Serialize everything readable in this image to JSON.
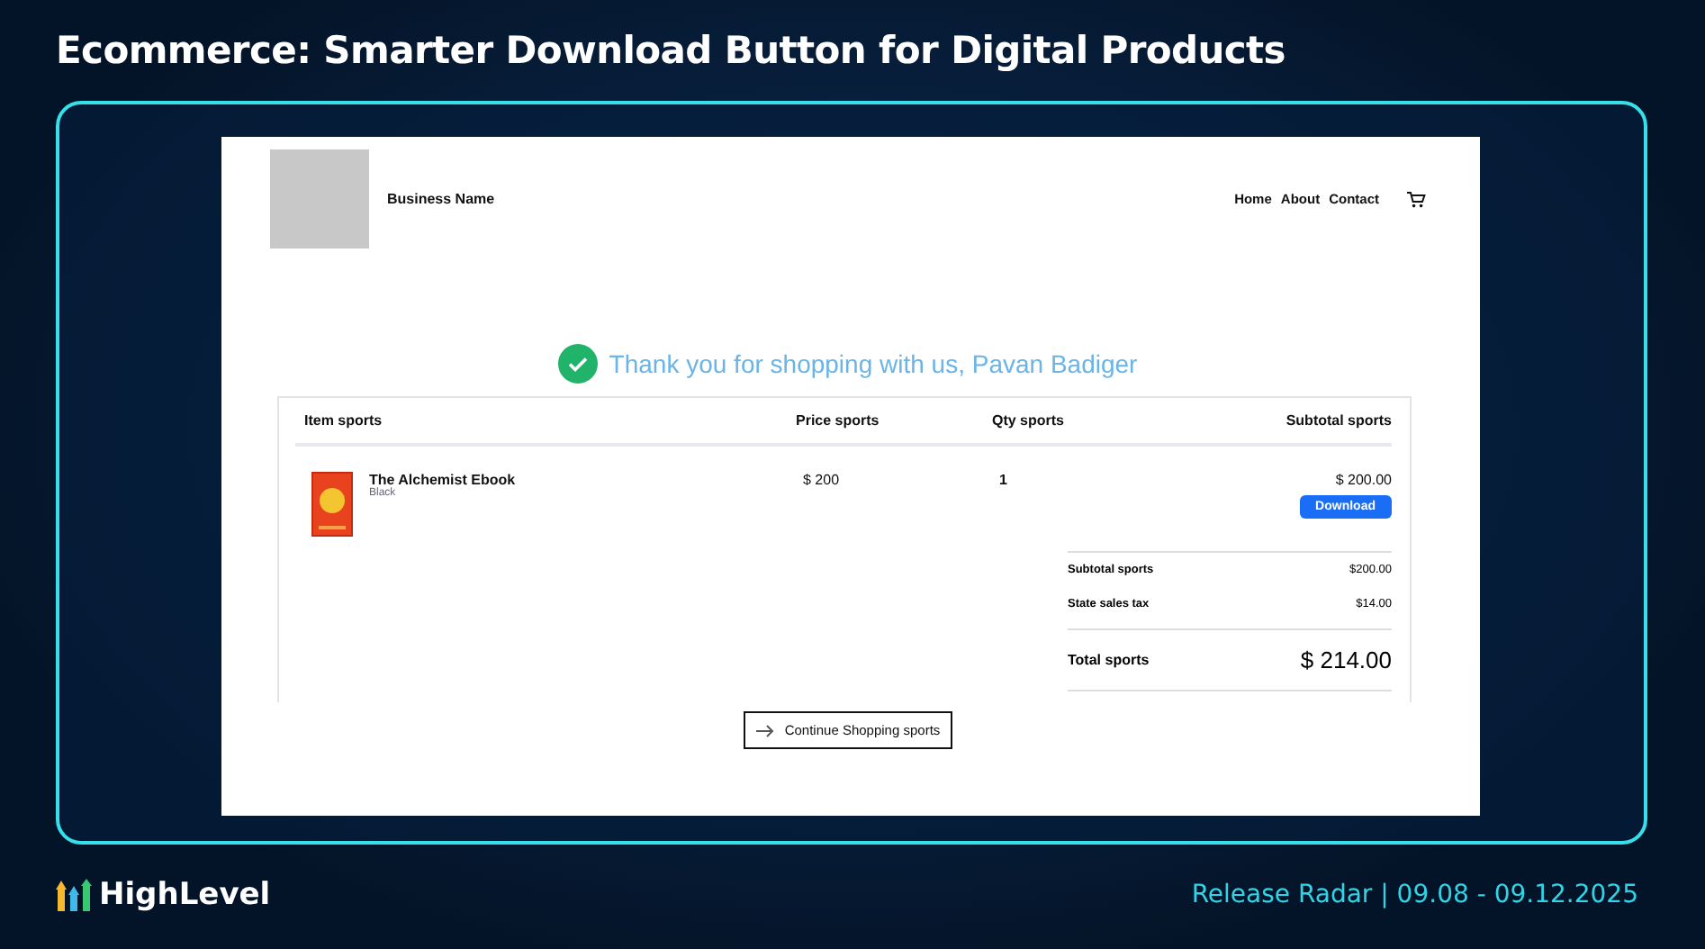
{
  "headline": "Ecommerce: Smarter Download Button for Digital Products",
  "site": {
    "business_name": "Business Name",
    "nav": [
      "Home",
      "About",
      "Contact"
    ]
  },
  "thank_you": "Thank you for shopping with us, Pavan Badiger",
  "table": {
    "columns": [
      "Item sports",
      "Price sports",
      "Qty sports",
      "Subtotal sports"
    ],
    "rows": [
      {
        "name": "The Alchemist Ebook",
        "variant": "Black",
        "price": "$ 200",
        "qty": "1",
        "subtotal": "$ 200.00",
        "button": "Download"
      }
    ]
  },
  "summary": [
    {
      "label": "Subtotal sports",
      "value": "$200.00",
      "kind": "line"
    },
    {
      "label": "State sales tax",
      "value": "$14.00",
      "kind": "line"
    },
    {
      "label": "Total sports",
      "value": "$ 214.00",
      "kind": "total"
    }
  ],
  "continue_button": "Continue Shopping sports",
  "footer": {
    "brand": "HighLevel",
    "release": "Release Radar | 09.08 - 09.12.2025"
  }
}
